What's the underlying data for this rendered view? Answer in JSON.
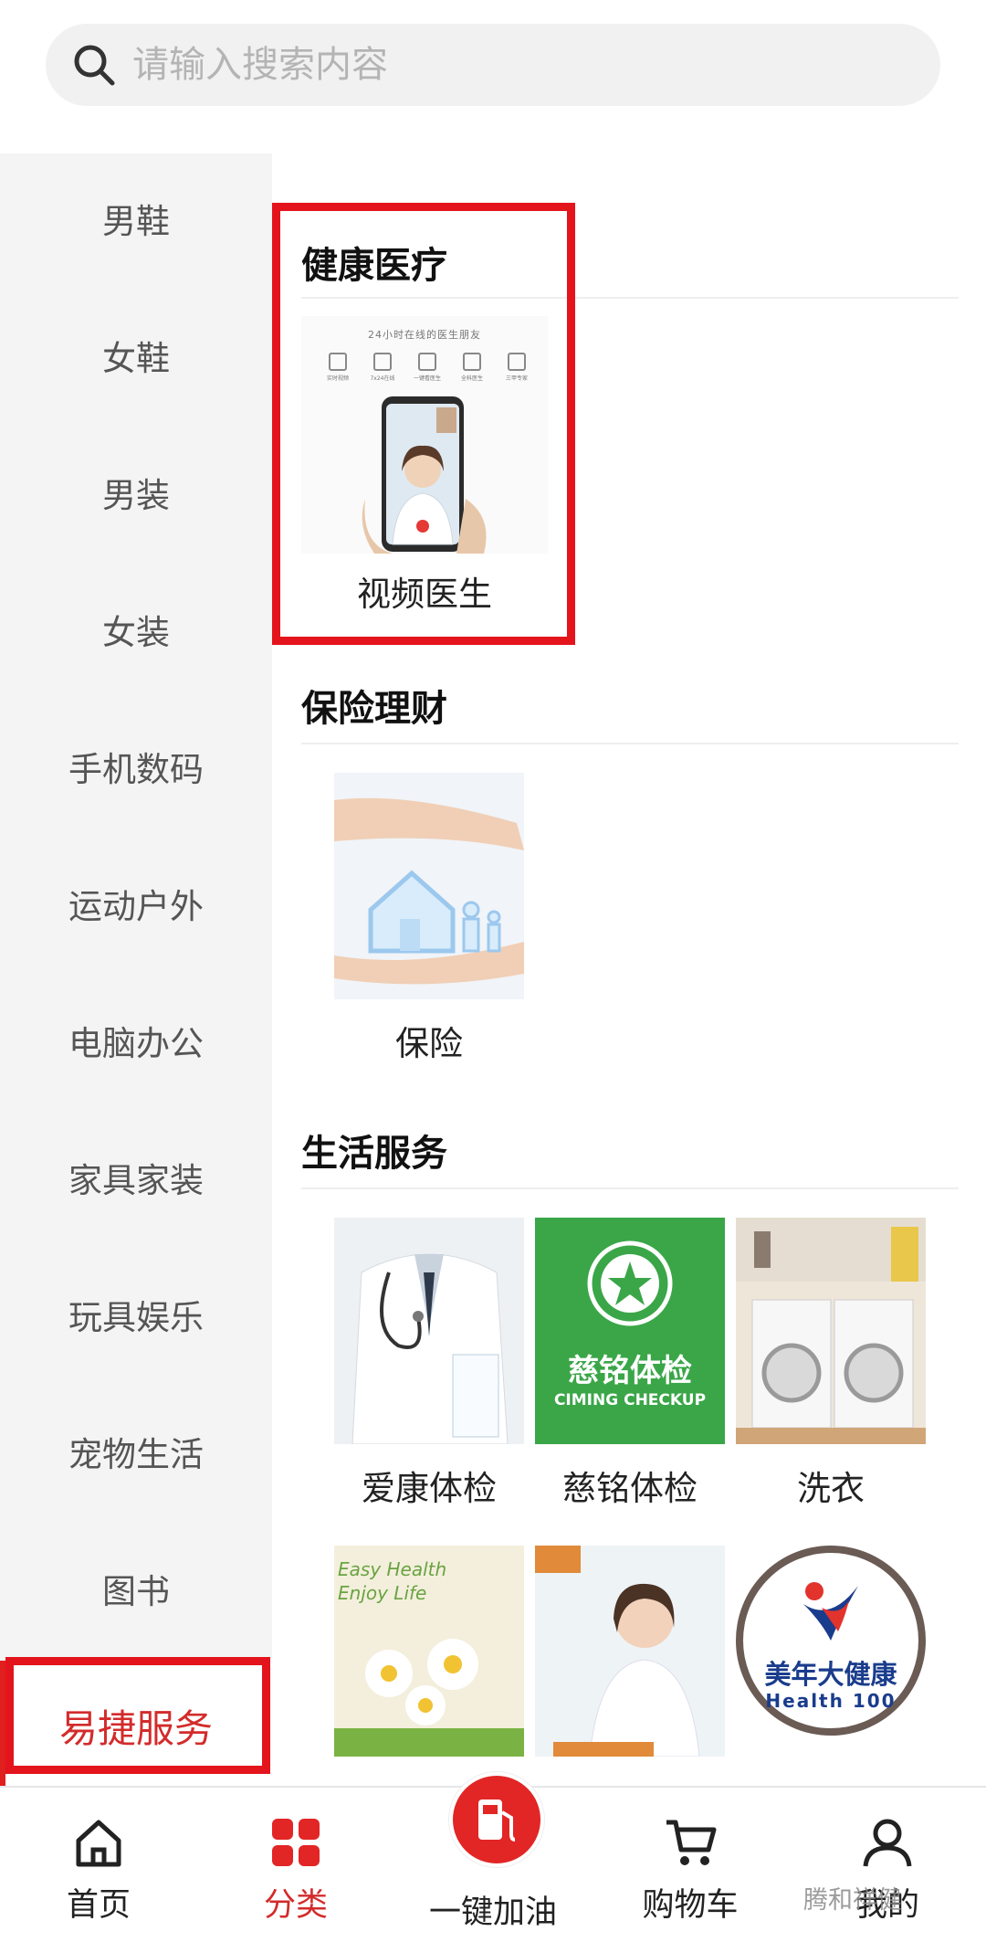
{
  "search": {
    "placeholder": "请输入搜索内容",
    "icon": "search-icon"
  },
  "sidebar": {
    "items": [
      {
        "label": "男鞋"
      },
      {
        "label": "女鞋"
      },
      {
        "label": "男装"
      },
      {
        "label": "女装"
      },
      {
        "label": "手机数码"
      },
      {
        "label": "运动户外"
      },
      {
        "label": "电脑办公"
      },
      {
        "label": "家具家装"
      },
      {
        "label": "玩具娱乐"
      },
      {
        "label": "宠物生活"
      },
      {
        "label": "图书"
      },
      {
        "label": "易捷服务",
        "active": true
      }
    ]
  },
  "sections": {
    "health": {
      "title": "健康医疗",
      "items": [
        {
          "label": "视频医生",
          "image_caption": "24小时在线的医生朋友",
          "features": [
            "实时视频",
            "7x24在线",
            "一键看医生",
            "全科医生",
            "三甲专家"
          ]
        }
      ]
    },
    "insurance": {
      "title": "保险理财",
      "items": [
        {
          "label": "保险"
        }
      ]
    },
    "life": {
      "title": "生活服务",
      "items": [
        {
          "label": "爱康体检"
        },
        {
          "label": "慈铭体检",
          "logo_cn": "慈铭体检",
          "logo_en": "CIMING CHECKUP"
        },
        {
          "label": "洗衣"
        },
        {
          "label": "",
          "image_text": [
            "Easy Health",
            "Enjoy Life"
          ]
        },
        {
          "label": ""
        },
        {
          "label": "",
          "logo_cn": "美年大健康",
          "logo_en": "Health 100"
        }
      ]
    }
  },
  "tabbar": {
    "tabs": [
      {
        "label": "首页",
        "icon": "home-icon"
      },
      {
        "label": "分类",
        "icon": "grid-icon",
        "active": true
      },
      {
        "label": "一键加油",
        "icon": "fuel-pump-icon"
      },
      {
        "label": "购物车",
        "icon": "cart-icon"
      },
      {
        "label": "我的",
        "icon": "user-icon"
      }
    ]
  },
  "watermark": "腾和祥健",
  "colors": {
    "accent": "#d32b2b",
    "highlight_frame": "#e4141c",
    "sidebar_bg": "#f4f4f4",
    "ciming_green": "#3aa648"
  }
}
